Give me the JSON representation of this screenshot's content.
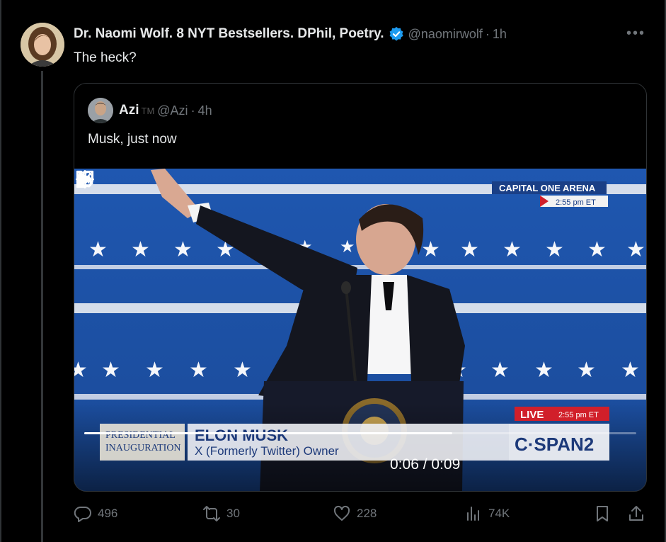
{
  "post": {
    "author_name": "Dr. Naomi Wolf. 8 NYT Bestsellers. DPhil, Poetry.",
    "author_handle": "@naomirwolf",
    "time": "1h",
    "text": "The heck?"
  },
  "quoted": {
    "author_name": "Azi",
    "tm_badge": "TM",
    "author_handle": "@Azi",
    "time": "4h",
    "text": "Musk, just now"
  },
  "video": {
    "overlay": {
      "venue": "CAPITAL ONE ARENA",
      "venue_time": "2:55 pm ET",
      "live_label": "LIVE",
      "live_time": "2:55 pm ET",
      "lower_left_line1": "PRESIDENTIAL",
      "lower_left_line2": "INAUGURATION",
      "chyron_name": "ELON MUSK",
      "chyron_title": "X (Formerly Twitter) Owner",
      "network": "C·SPAN2"
    },
    "elapsed": "0:06",
    "duration": "0:09",
    "time_display": "0:06 / 0:09",
    "progress": 0.6667
  },
  "actions": {
    "replies": "496",
    "reposts": "30",
    "likes": "228",
    "views": "74K"
  },
  "colors": {
    "background": "#000000",
    "text_primary": "#e7e9ea",
    "text_secondary": "#71767b",
    "verified": "#1d9bf0",
    "border": "#2f3336"
  }
}
